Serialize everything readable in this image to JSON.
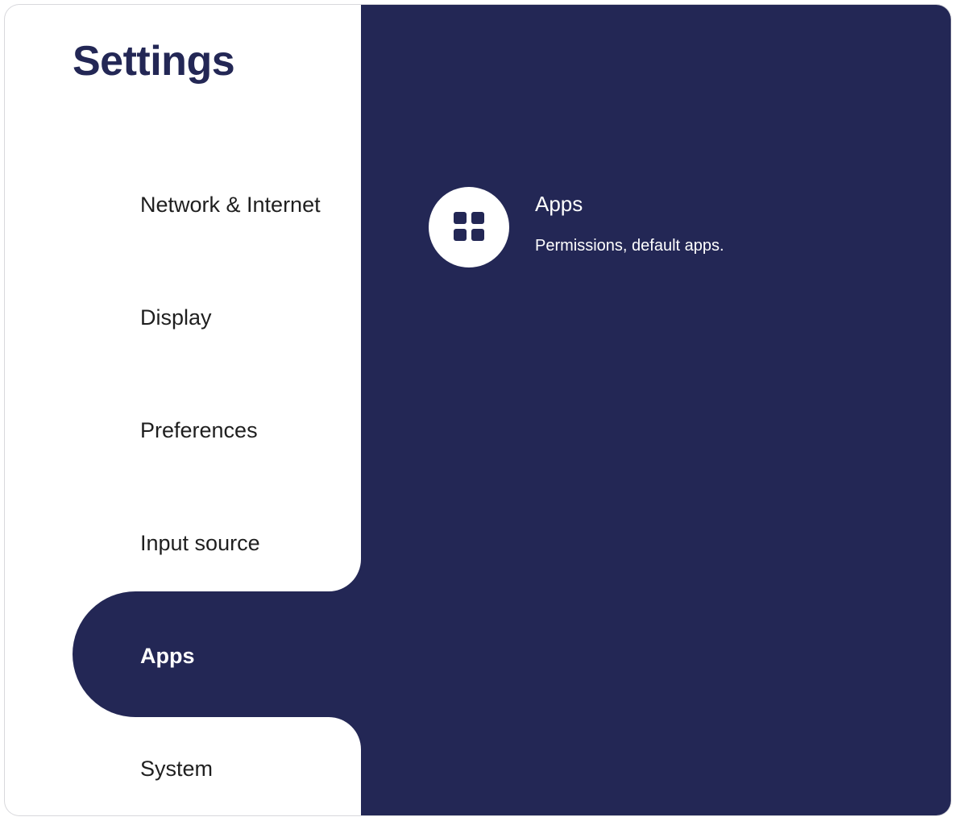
{
  "app": {
    "title": "Settings"
  },
  "colors": {
    "accent": "#232755",
    "background": "#ffffff",
    "text": "#1f1f1f"
  },
  "sidebar": {
    "items": [
      {
        "label": "Network & Internet",
        "selected": false
      },
      {
        "label": "Display",
        "selected": false
      },
      {
        "label": "Preferences",
        "selected": false
      },
      {
        "label": "Input source",
        "selected": false
      },
      {
        "label": "Apps",
        "selected": true
      },
      {
        "label": "System",
        "selected": false
      }
    ]
  },
  "main": {
    "items": [
      {
        "icon": "apps-grid-icon",
        "title": "Apps",
        "subtitle": "Permissions, default apps."
      }
    ]
  }
}
